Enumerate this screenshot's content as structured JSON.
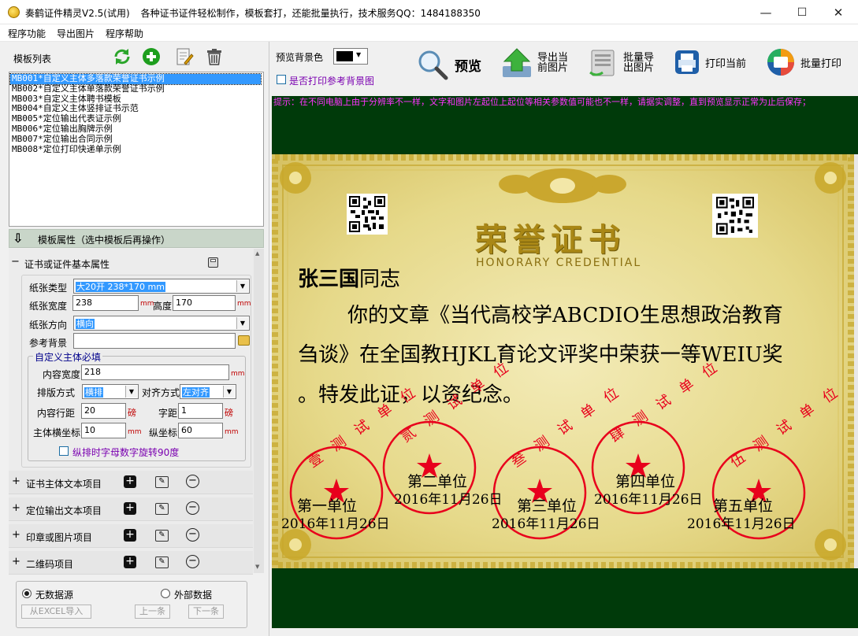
{
  "window": {
    "title": "奏鹤证件精灵V2.5(试用)",
    "subtitle": "各种证书证件轻松制作，模板套打，还能批量执行，技术服务QQ：1484188350",
    "min": "—",
    "max": "☐",
    "close": "✕"
  },
  "menu": [
    "程序功能",
    "导出图片",
    "程序帮助"
  ],
  "left": {
    "template_list_label": "模板列表",
    "templates": [
      "MB001*自定义主体多落款荣誉证书示例",
      "MB002*自定义主体单落款荣誉证书示例",
      "MB003*自定义主体聘书模板",
      "MB004*自定义主体竖排证书示范",
      "MB005*定位输出代表证示例",
      "MB006*定位输出胸牌示例",
      "MB007*定位输出合同示例",
      "MB008*定位打印快递单示例"
    ],
    "props_title": "模板属性（选中模板后再操作）",
    "basic_section": "证书或证件基本属性",
    "basic_pm": "−",
    "fields": {
      "paper_type_label": "纸张类型",
      "paper_type": "大20开 238*170 mm",
      "paper_width_label": "纸张宽度",
      "paper_width": "238",
      "height_label": "高度",
      "height": "170",
      "direction_label": "纸张方向",
      "direction": "横向",
      "bg_label": "参考背景",
      "group_title": "自定义主体必填",
      "content_width_label": "内容宽度",
      "content_width": "218",
      "layout_label": "排版方式",
      "layout": "横排",
      "align_label": "对齐方式",
      "align": "左对齐",
      "line_spacing_label": "内容行距",
      "line_spacing": "20",
      "char_spacing_label": "字距",
      "char_spacing": "1",
      "x_label": "主体横坐标",
      "x": "10",
      "y_label": "纵坐标",
      "y": "60",
      "unit_mm": "mm",
      "unit_pt": "磅",
      "rotate_label": "纵排时字母数字旋转90度"
    },
    "sections": [
      "证书主体文本项目",
      "定位输出文本项目",
      "印章或图片项目",
      "二维码项目"
    ],
    "section_pm": "+",
    "datasource": {
      "none": "无数据源",
      "external": "外部数据",
      "import_btn": "从EXCEL导入",
      "prev_btn": "上一条",
      "next_btn": "下一条"
    }
  },
  "toolbar": {
    "bg_color_label": "预览背景色",
    "print_bg_label": "是否打印参考背景图",
    "preview": "预览",
    "export_current_1": "导出当",
    "export_current_2": "前图片",
    "batch_export_1": "批量导",
    "batch_export_2": "出图片",
    "print_current": "打印当前",
    "batch_print": "批量打印"
  },
  "preview": {
    "hint": "提示：在不同电脑上由于分辨率不一样，文字和图片左起位上起位等相关参数值可能也不一样，请据实调整，直到预览显示正常为止后保存；",
    "title_cn": "荣誉证书",
    "title_en": "HONORARY CREDENTIAL",
    "name": "张三国",
    "salutation": "同志",
    "body_line1": "你的文章《当代高校学ABCDIO生思想政治教育",
    "body_line2": "刍谈》在全国教HJKL育论文评奖中荣获一等WEIU奖",
    "body_line3": "。特发此证，以资纪念。",
    "units": [
      {
        "name": "第一单位",
        "date": "2016年11月26日",
        "stamp": "壹 测 试 单 位"
      },
      {
        "name": "第二单位",
        "date": "2016年11月26日",
        "stamp": "贰 测 试 单 位"
      },
      {
        "name": "第三单位",
        "date": "2016年11月26日",
        "stamp": "叁 测 试 单 位"
      },
      {
        "name": "第四单位",
        "date": "2016年11月26日",
        "stamp": "肆 测 试 单 位"
      },
      {
        "name": "第五单位",
        "date": "2016年11月26日",
        "stamp": "伍 测 试 单 位"
      }
    ],
    "colors": {
      "frame": "#003a0a",
      "stamp": "#e8001c",
      "gold": "#b8951c",
      "hint": "#ff33ff"
    }
  }
}
